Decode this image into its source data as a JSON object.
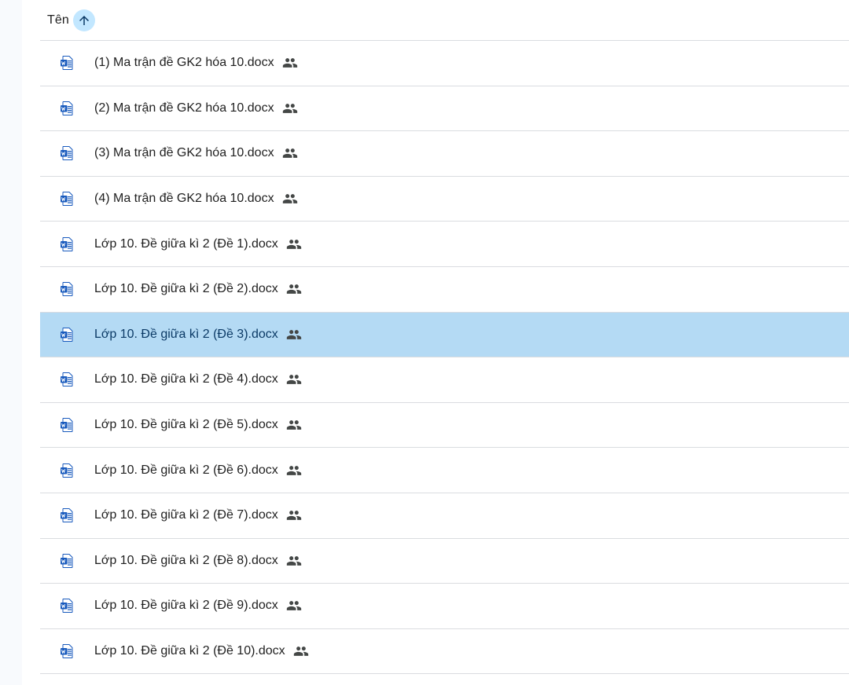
{
  "header": {
    "name_column_label": "Tên",
    "sort_direction": "ascending"
  },
  "colors": {
    "selected_row": "#b4daf4",
    "sort_button": "#c2e7ff",
    "word_blue": "#185abd",
    "divider": "#dadce0"
  },
  "files": [
    {
      "name": "(1) Ma trận đề GK2 hóa 10.docx",
      "icon": "word-doc-icon",
      "shared": true,
      "selected": false
    },
    {
      "name": "(2) Ma trận đề GK2 hóa 10.docx",
      "icon": "word-doc-icon",
      "shared": true,
      "selected": false
    },
    {
      "name": "(3) Ma trận đề GK2 hóa 10.docx",
      "icon": "word-doc-icon",
      "shared": true,
      "selected": false
    },
    {
      "name": "(4) Ma trận đề GK2 hóa 10.docx",
      "icon": "word-doc-icon",
      "shared": true,
      "selected": false
    },
    {
      "name": "Lớp 10. Đề giữa kì 2 (Đề 1).docx",
      "icon": "word-doc-icon",
      "shared": true,
      "selected": false
    },
    {
      "name": "Lớp 10. Đề giữa kì 2 (Đề 2).docx",
      "icon": "word-doc-icon",
      "shared": true,
      "selected": false
    },
    {
      "name": "Lớp 10. Đề giữa kì 2 (Đề 3).docx",
      "icon": "word-doc-icon",
      "shared": true,
      "selected": true
    },
    {
      "name": "Lớp 10. Đề giữa kì 2 (Đề 4).docx",
      "icon": "word-doc-icon",
      "shared": true,
      "selected": false
    },
    {
      "name": "Lớp 10. Đề giữa kì 2 (Đề 5).docx",
      "icon": "word-doc-icon",
      "shared": true,
      "selected": false
    },
    {
      "name": "Lớp 10. Đề giữa kì 2 (Đề 6).docx",
      "icon": "word-doc-icon",
      "shared": true,
      "selected": false
    },
    {
      "name": "Lớp 10. Đề giữa kì 2 (Đề 7).docx",
      "icon": "word-doc-icon",
      "shared": true,
      "selected": false
    },
    {
      "name": "Lớp 10. Đề giữa kì 2 (Đề 8).docx",
      "icon": "word-doc-icon",
      "shared": true,
      "selected": false
    },
    {
      "name": "Lớp 10. Đề giữa kì 2 (Đề 9).docx",
      "icon": "word-doc-icon",
      "shared": true,
      "selected": false
    },
    {
      "name": "Lớp 10. Đề giữa kì 2 (Đề 10).docx",
      "icon": "word-doc-icon",
      "shared": true,
      "selected": false
    }
  ]
}
